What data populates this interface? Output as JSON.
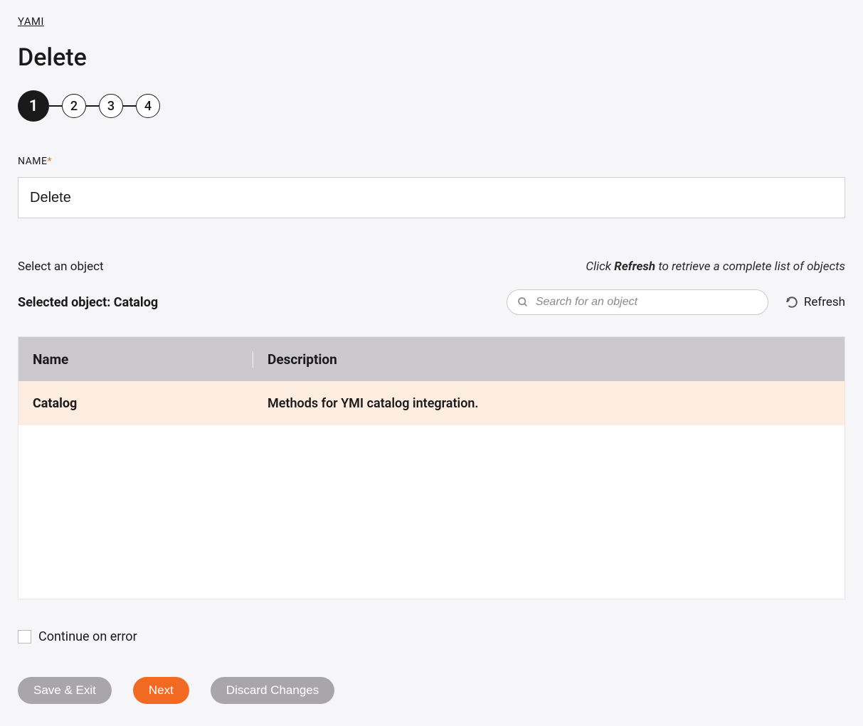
{
  "breadcrumb": "YAMI",
  "title": "Delete",
  "stepper": {
    "steps": [
      "1",
      "2",
      "3",
      "4"
    ],
    "active_index": 0
  },
  "name_field": {
    "label": "NAME",
    "value": "Delete"
  },
  "select_object": {
    "label": "Select an object",
    "hint_prefix": "Click ",
    "hint_bold": "Refresh",
    "hint_suffix": " to retrieve a complete list of objects",
    "selected_prefix": "Selected object: ",
    "selected_value": "Catalog",
    "search_placeholder": "Search for an object",
    "refresh_label": "Refresh"
  },
  "table": {
    "headers": {
      "name": "Name",
      "description": "Description"
    },
    "rows": [
      {
        "name": "Catalog",
        "description": "Methods for YMI catalog integration.",
        "selected": true
      }
    ]
  },
  "continue_on_error": {
    "label": "Continue on error",
    "checked": false
  },
  "buttons": {
    "save_exit": "Save & Exit",
    "next": "Next",
    "discard": "Discard Changes"
  }
}
